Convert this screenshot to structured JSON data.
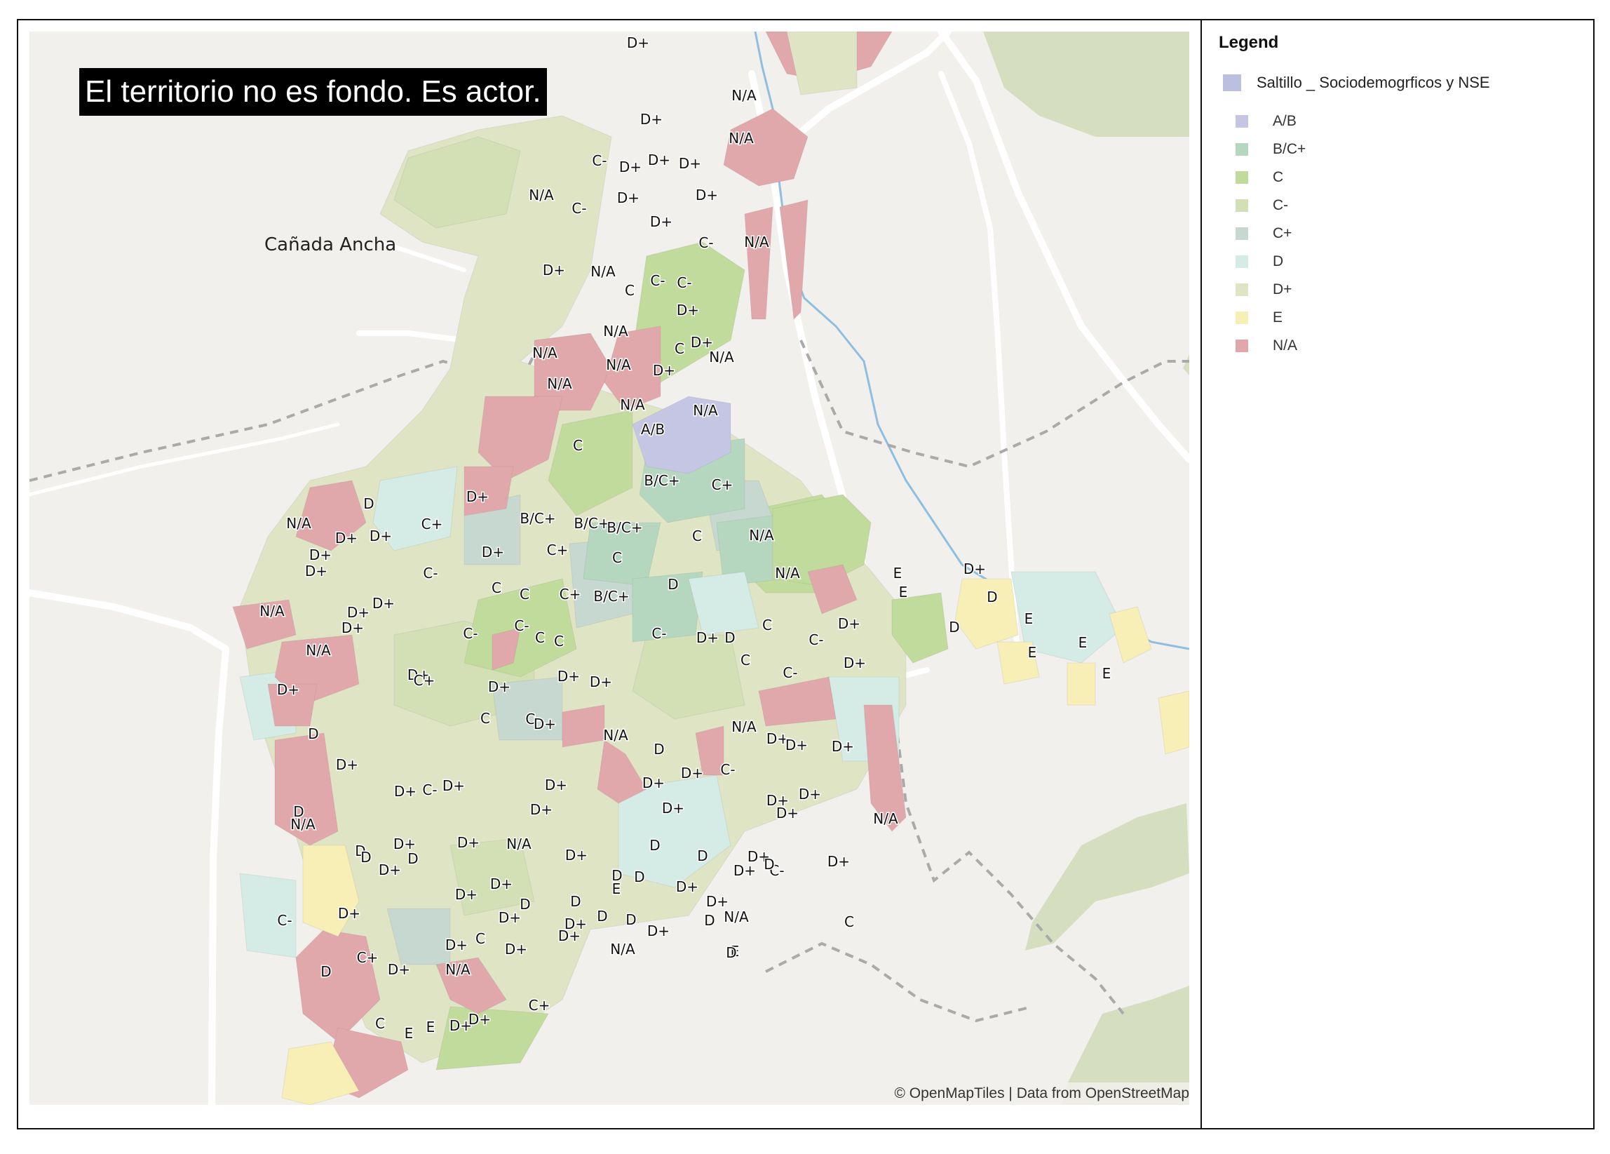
{
  "map": {
    "title": "El territorio no es fondo. Es actor.",
    "place_label": "Cañada Ancha",
    "attribution": "© OpenMapTiles | Data from OpenStreetMap",
    "basemap_colors": {
      "land": "#f2f0ec",
      "vegetation": "#d5dfc0",
      "road": "#ffffff",
      "river": "#8fbfe0",
      "boundary": "#aaaaaa"
    },
    "zone_labels": [
      "D+",
      "N/A",
      "N/A",
      "D+",
      "C-",
      "D+",
      "D+",
      "D+",
      "N/A",
      "C-",
      "D+",
      "D+",
      "D+",
      "C-",
      "N/A",
      "D+",
      "N/A",
      "C",
      "C-",
      "C-",
      "D+",
      "N/A",
      "N/A",
      "N/A",
      "N/A",
      "C",
      "D+",
      "N/A",
      "D+",
      "N/A",
      "N/A",
      "A/B",
      "C",
      "B/C+",
      "C+",
      "D",
      "D+",
      "N/A",
      "D+",
      "D+",
      "C+",
      "D+",
      "B/C+",
      "B/C+",
      "B/C+",
      "C",
      "N/A",
      "D+",
      "C-",
      "D+",
      "C+",
      "C",
      "N/A",
      "C",
      "C",
      "C+",
      "B/C+",
      "D",
      "N/A",
      "D+",
      "D+",
      "D+",
      "C-",
      "C",
      "C-",
      "C-",
      "D+",
      "C",
      "D+",
      "D",
      "C-",
      "N/A",
      "C",
      "D+",
      "C",
      "C-",
      "D+",
      "D+",
      "D+",
      "D+",
      "C+",
      "C",
      "C-",
      "D+",
      "N/A",
      "D",
      "D+",
      "N/A",
      "D",
      "D+",
      "D+",
      "D+",
      "D+",
      "D+",
      "D+",
      "C-",
      "D+",
      "D+",
      "C-",
      "D+",
      "D+",
      "D+",
      "D+",
      "D+",
      "D",
      "N/A",
      "N/A",
      "D+",
      "D+",
      "D+",
      "N/A",
      "D",
      "D",
      "D+",
      "D",
      "D+",
      "D+",
      "D",
      "D",
      "D+",
      "D+",
      "D+",
      "D",
      "D",
      "D+",
      "C-",
      "D+",
      "D",
      "D+",
      "D+",
      "D",
      "D",
      "E",
      "D",
      "D+",
      "D+",
      "D+",
      "C",
      "C-",
      "D",
      "N/A",
      "C",
      "D+",
      "N/A",
      "D+",
      "D",
      "C+",
      "D+",
      "N/A",
      "D+",
      "D",
      "D+",
      "E",
      "D+",
      "C+",
      "C",
      "E",
      "E",
      "D",
      "E",
      "E",
      "D+",
      "D",
      "D",
      "E",
      "E",
      "E",
      "E"
    ]
  },
  "legend": {
    "title": "Legend",
    "layer": {
      "label": "Saltillo _ Sociodemogrficos y NSE",
      "color": "#bcc0e0"
    },
    "items": [
      {
        "label": "A/B",
        "color": "#c4c6e4"
      },
      {
        "label": "B/C+",
        "color": "#b5d7bf"
      },
      {
        "label": "C",
        "color": "#c1db9c"
      },
      {
        "label": "C-",
        "color": "#d3e0b6"
      },
      {
        "label": "C+",
        "color": "#c7d8d0"
      },
      {
        "label": "D",
        "color": "#d5ebe6"
      },
      {
        "label": "D+",
        "color": "#dfe5c4"
      },
      {
        "label": "E",
        "color": "#f8efb6"
      },
      {
        "label": "N/A",
        "color": "#e1a8ab"
      }
    ]
  }
}
